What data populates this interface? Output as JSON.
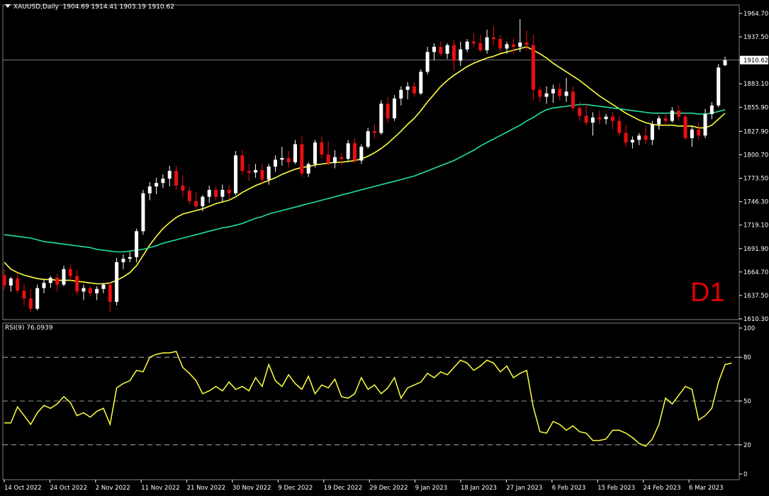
{
  "header": {
    "symbol": "XAUUSD,Daily",
    "ohlc": "1904.69 1914.41 1903.19 1910.62"
  },
  "timeframe_label": "D1",
  "rsi_label": "RSI(9) 76.0939",
  "colors": {
    "background": "#000000",
    "bull_candle": "#ffffff",
    "bear_candle": "#e81010",
    "ma_fast": "#ffff40",
    "ma_slow": "#20e0a0",
    "rsi_line": "#ffff40",
    "grid": "#808080"
  },
  "chart_data": [
    {
      "type": "candlestick",
      "title": "XAUUSD,Daily",
      "price_axis_ticks": [
        "1964.70",
        "1937.50",
        "1910.62",
        "1883.10",
        "1855.90",
        "1827.90",
        "1800.70",
        "1773.50",
        "1746.30",
        "1719.10",
        "1691.90",
        "1664.70",
        "1637.50",
        "1610.30"
      ],
      "ylim": [
        1605,
        1974
      ],
      "date_axis_ticks": [
        "14 Oct 2022",
        "24 Oct 2022",
        "2 Nov 2022",
        "11 Nov 2022",
        "21 Nov 2022",
        "30 Nov 2022",
        "9 Dec 2022",
        "19 Dec 2022",
        "29 Dec 2022",
        "9 Jan 2023",
        "18 Jan 2023",
        "27 Jan 2023",
        "6 Feb 2023",
        "15 Feb 2023",
        "24 Feb 2023",
        "6 Mar 2023"
      ],
      "current_price": 1910.62,
      "ohlc": [
        [
          1661,
          1668,
          1644,
          1649
        ],
        [
          1649,
          1659,
          1642,
          1657
        ],
        [
          1657,
          1664,
          1640,
          1643
        ],
        [
          1643,
          1651,
          1626,
          1634
        ],
        [
          1634,
          1645,
          1618,
          1622
        ],
        [
          1622,
          1650,
          1620,
          1646
        ],
        [
          1646,
          1656,
          1640,
          1652
        ],
        [
          1652,
          1660,
          1646,
          1658
        ],
        [
          1658,
          1663,
          1642,
          1650
        ],
        [
          1650,
          1672,
          1648,
          1668
        ],
        [
          1668,
          1674,
          1655,
          1660
        ],
        [
          1660,
          1667,
          1638,
          1642
        ],
        [
          1642,
          1650,
          1632,
          1646
        ],
        [
          1646,
          1648,
          1636,
          1640
        ],
        [
          1640,
          1648,
          1632,
          1645
        ],
        [
          1645,
          1652,
          1640,
          1650
        ],
        [
          1650,
          1653,
          1618,
          1630
        ],
        [
          1630,
          1681,
          1626,
          1676
        ],
        [
          1676,
          1685,
          1668,
          1680
        ],
        [
          1680,
          1688,
          1676,
          1682
        ],
        [
          1682,
          1715,
          1676,
          1712
        ],
        [
          1712,
          1760,
          1708,
          1756
        ],
        [
          1756,
          1769,
          1748,
          1764
        ],
        [
          1764,
          1774,
          1755,
          1768
        ],
        [
          1768,
          1778,
          1762,
          1773
        ],
        [
          1773,
          1788,
          1764,
          1782
        ],
        [
          1782,
          1788,
          1760,
          1765
        ],
        [
          1765,
          1777,
          1752,
          1759
        ],
        [
          1759,
          1763,
          1743,
          1747
        ],
        [
          1747,
          1758,
          1738,
          1741
        ],
        [
          1741,
          1754,
          1735,
          1752
        ],
        [
          1752,
          1765,
          1745,
          1760
        ],
        [
          1760,
          1764,
          1748,
          1752
        ],
        [
          1752,
          1766,
          1746,
          1760
        ],
        [
          1760,
          1766,
          1748,
          1756
        ],
        [
          1756,
          1805,
          1754,
          1800
        ],
        [
          1800,
          1806,
          1778,
          1782
        ],
        [
          1782,
          1790,
          1770,
          1780
        ],
        [
          1780,
          1790,
          1774,
          1783
        ],
        [
          1783,
          1790,
          1766,
          1772
        ],
        [
          1772,
          1790,
          1766,
          1787
        ],
        [
          1787,
          1800,
          1781,
          1795
        ],
        [
          1795,
          1810,
          1788,
          1797
        ],
        [
          1797,
          1805,
          1786,
          1792
        ],
        [
          1792,
          1818,
          1790,
          1813
        ],
        [
          1813,
          1822,
          1775,
          1779
        ],
        [
          1779,
          1792,
          1775,
          1790
        ],
        [
          1790,
          1818,
          1786,
          1815
        ],
        [
          1815,
          1822,
          1796,
          1801
        ],
        [
          1801,
          1816,
          1788,
          1791
        ],
        [
          1791,
          1806,
          1785,
          1798
        ],
        [
          1798,
          1803,
          1789,
          1796
        ],
        [
          1796,
          1818,
          1794,
          1814
        ],
        [
          1814,
          1820,
          1791,
          1794
        ],
        [
          1794,
          1813,
          1790,
          1810
        ],
        [
          1810,
          1832,
          1808,
          1828
        ],
        [
          1828,
          1836,
          1820,
          1826
        ],
        [
          1826,
          1864,
          1824,
          1860
        ],
        [
          1860,
          1868,
          1838,
          1843
        ],
        [
          1843,
          1870,
          1840,
          1866
        ],
        [
          1866,
          1880,
          1858,
          1876
        ],
        [
          1876,
          1885,
          1865,
          1880
        ],
        [
          1880,
          1885,
          1868,
          1872
        ],
        [
          1872,
          1900,
          1870,
          1897
        ],
        [
          1897,
          1926,
          1894,
          1920
        ],
        [
          1920,
          1930,
          1910,
          1926
        ],
        [
          1926,
          1932,
          1915,
          1918
        ],
        [
          1918,
          1930,
          1912,
          1928
        ],
        [
          1928,
          1934,
          1898,
          1910
        ],
        [
          1910,
          1932,
          1904,
          1923
        ],
        [
          1923,
          1935,
          1920,
          1932
        ],
        [
          1932,
          1942,
          1925,
          1930
        ],
        [
          1930,
          1940,
          1920,
          1922
        ],
        [
          1922,
          1946,
          1918,
          1937
        ],
        [
          1937,
          1950,
          1928,
          1935
        ],
        [
          1935,
          1940,
          1920,
          1924
        ],
        [
          1924,
          1932,
          1918,
          1929
        ],
        [
          1929,
          1936,
          1918,
          1926
        ],
        [
          1926,
          1958,
          1920,
          1931
        ],
        [
          1931,
          1945,
          1922,
          1928
        ],
        [
          1928,
          1940,
          1864,
          1876
        ],
        [
          1876,
          1880,
          1862,
          1868
        ],
        [
          1868,
          1880,
          1860,
          1872
        ],
        [
          1872,
          1882,
          1861,
          1877
        ],
        [
          1877,
          1884,
          1864,
          1869
        ],
        [
          1869,
          1890,
          1862,
          1874
        ],
        [
          1874,
          1880,
          1852,
          1855
        ],
        [
          1855,
          1862,
          1840,
          1846
        ],
        [
          1846,
          1860,
          1835,
          1838
        ],
        [
          1838,
          1850,
          1823,
          1844
        ],
        [
          1844,
          1852,
          1836,
          1842
        ],
        [
          1842,
          1848,
          1836,
          1845
        ],
        [
          1845,
          1850,
          1830,
          1840
        ],
        [
          1840,
          1846,
          1822,
          1826
        ],
        [
          1826,
          1835,
          1810,
          1815
        ],
        [
          1815,
          1822,
          1808,
          1818
        ],
        [
          1818,
          1826,
          1812,
          1823
        ],
        [
          1823,
          1834,
          1813,
          1818
        ],
        [
          1818,
          1840,
          1812,
          1836
        ],
        [
          1836,
          1846,
          1830,
          1843
        ],
        [
          1843,
          1849,
          1835,
          1840
        ],
        [
          1840,
          1856,
          1838,
          1852
        ],
        [
          1852,
          1858,
          1840,
          1845
        ],
        [
          1845,
          1850,
          1818,
          1820
        ],
        [
          1820,
          1834,
          1810,
          1830
        ],
        [
          1830,
          1838,
          1818,
          1823
        ],
        [
          1823,
          1854,
          1820,
          1848
        ],
        [
          1848,
          1862,
          1842,
          1858
        ],
        [
          1858,
          1906,
          1856,
          1902
        ],
        [
          1904.69,
          1914.41,
          1903.19,
          1910.62
        ]
      ],
      "series": [
        {
          "name": "",
          "color": "#ffff40",
          "values": [
            1676,
            1668,
            1664,
            1661,
            1659,
            1657,
            1656,
            1656,
            1655,
            1655,
            1655,
            1654,
            1653,
            1652,
            1651,
            1651,
            1652,
            1655,
            1659,
            1664,
            1672,
            1684,
            1696,
            1706,
            1715,
            1722,
            1728,
            1732,
            1734,
            1736,
            1738,
            1741,
            1744,
            1746,
            1748,
            1752,
            1757,
            1761,
            1765,
            1768,
            1771,
            1774,
            1778,
            1781,
            1784,
            1786,
            1787,
            1789,
            1790,
            1791,
            1792,
            1792,
            1793,
            1794,
            1796,
            1799,
            1803,
            1808,
            1814,
            1821,
            1828,
            1836,
            1843,
            1852,
            1862,
            1871,
            1880,
            1887,
            1893,
            1898,
            1903,
            1907,
            1910,
            1913,
            1915,
            1918,
            1920,
            1922,
            1924,
            1926,
            1922,
            1918,
            1913,
            1907,
            1902,
            1897,
            1892,
            1887,
            1881,
            1875,
            1869,
            1864,
            1859,
            1854,
            1849,
            1845,
            1841,
            1838,
            1836,
            1835,
            1835,
            1835,
            1834,
            1834,
            1834,
            1832,
            1832,
            1835,
            1842,
            1849
          ]
        },
        {
          "name": "",
          "color": "#20e0a0",
          "values": [
            1708,
            1707,
            1706,
            1705,
            1704,
            1702,
            1700,
            1699,
            1698,
            1697,
            1696,
            1695,
            1694,
            1693,
            1691,
            1690,
            1689,
            1688,
            1688,
            1689,
            1690,
            1691,
            1693,
            1695,
            1698,
            1700,
            1702,
            1704,
            1706,
            1708,
            1710,
            1712,
            1714,
            1716,
            1717,
            1719,
            1721,
            1724,
            1727,
            1729,
            1732,
            1734,
            1736,
            1738,
            1740,
            1742,
            1744,
            1746,
            1748,
            1750,
            1752,
            1754,
            1756,
            1758,
            1760,
            1762,
            1764,
            1766,
            1768,
            1770,
            1772,
            1774,
            1776,
            1779,
            1782,
            1785,
            1788,
            1791,
            1794,
            1798,
            1802,
            1806,
            1811,
            1815,
            1819,
            1823,
            1827,
            1831,
            1835,
            1840,
            1844,
            1849,
            1853,
            1855,
            1856,
            1857,
            1858,
            1859,
            1859,
            1858,
            1857,
            1856,
            1855,
            1854,
            1853,
            1852,
            1851,
            1850,
            1849,
            1849,
            1849,
            1849,
            1849,
            1849,
            1849,
            1848,
            1848,
            1849,
            1851,
            1853
          ]
        }
      ]
    },
    {
      "type": "line",
      "title": "RSI(9) 76.0939",
      "ylim": [
        0,
        100
      ],
      "levels": [
        80,
        50,
        20
      ],
      "y_ticks": [
        "100",
        "80",
        "50",
        "20",
        "0"
      ],
      "series": [
        {
          "name": "",
          "color": "#ffff40",
          "values": [
            35,
            35,
            46,
            40,
            34,
            42,
            47,
            45,
            48,
            53,
            49,
            40,
            42,
            39,
            43,
            45,
            34,
            59,
            62,
            64,
            71,
            70,
            80,
            82,
            83,
            83,
            84,
            73,
            69,
            64,
            55,
            57,
            60,
            57,
            63,
            58,
            60,
            57,
            66,
            60,
            75,
            64,
            60,
            68,
            62,
            58,
            67,
            55,
            61,
            59,
            65,
            53,
            52,
            55,
            66,
            58,
            61,
            55,
            59,
            66,
            52,
            59,
            61,
            63,
            69,
            66,
            70,
            68,
            73,
            78,
            76,
            71,
            74,
            78,
            76,
            70,
            74,
            66,
            69,
            71,
            46,
            29,
            28,
            36,
            34,
            30,
            33,
            29,
            28,
            23,
            23,
            24,
            30,
            30,
            28,
            25,
            21,
            19,
            24,
            34,
            52,
            48,
            54,
            60,
            58,
            37,
            40,
            45,
            63,
            75,
            76
          ]
        }
      ]
    }
  ]
}
